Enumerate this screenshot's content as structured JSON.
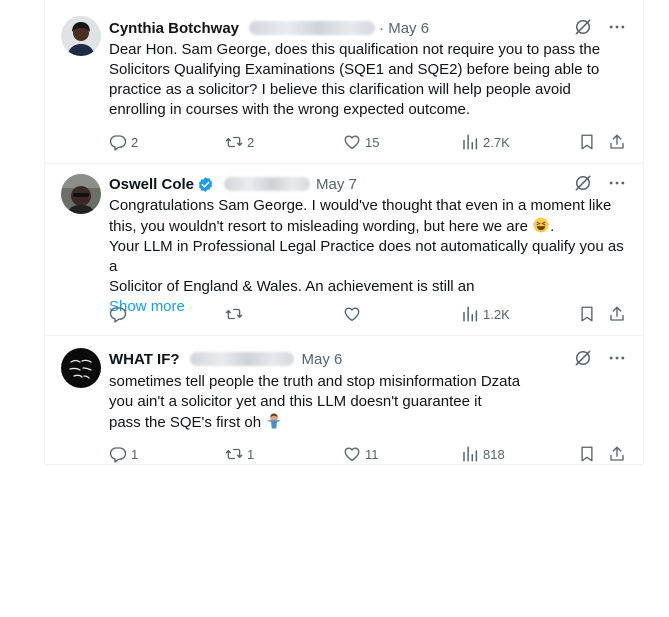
{
  "tweets": [
    {
      "author": "Cynthia Botchway",
      "date": "· May 6",
      "lines": [
        "Dear Hon. Sam George, does this qualification not require you to pass the",
        "Solicitors Qualifying Examinations (SQE1 and SQE2) before being able to",
        "practice as a solicitor? I believe this clarification will help people avoid",
        "enrolling in courses with the wrong expected outcome."
      ],
      "replies": "2",
      "reposts": "2",
      "likes": "15",
      "views": "2.7K"
    },
    {
      "author": "Oswell Cole",
      "date": "May 7",
      "lines": [
        "Congratulations Sam George. I would've thought that even in a moment like",
        "this, you wouldn't resort to misleading wording, but here we are",
        "Your LLM in Professional Legal Practice does not automatically qualify you as a",
        "Solicitor of England & Wales. An achievement is still an"
      ],
      "show_more": "Show more",
      "views": "1.2K"
    },
    {
      "author": "WHAT IF?",
      "date": "May 6",
      "lines": [
        "sometimes tell people the truth and stop misinformation Dzata",
        "you ain't a solicitor yet and this LLM doesn't guarantee it",
        "pass the SQE's first oh"
      ],
      "replies": "1",
      "reposts": "1",
      "likes": "11",
      "views": "818"
    }
  ],
  "icons": {
    "header": [
      "grok-icon",
      "more-icon"
    ],
    "actions": [
      "reply-icon",
      "repost-icon",
      "like-icon",
      "views-icon",
      "bookmark-icon",
      "share-icon"
    ],
    "emoji": [
      "laughing-emoji",
      "person-shrugging-emoji"
    ]
  },
  "colors": {
    "link": "#1d9bf0",
    "muted": "#536471",
    "verified": "#1d9bf0",
    "divider": "#eff3f4"
  }
}
